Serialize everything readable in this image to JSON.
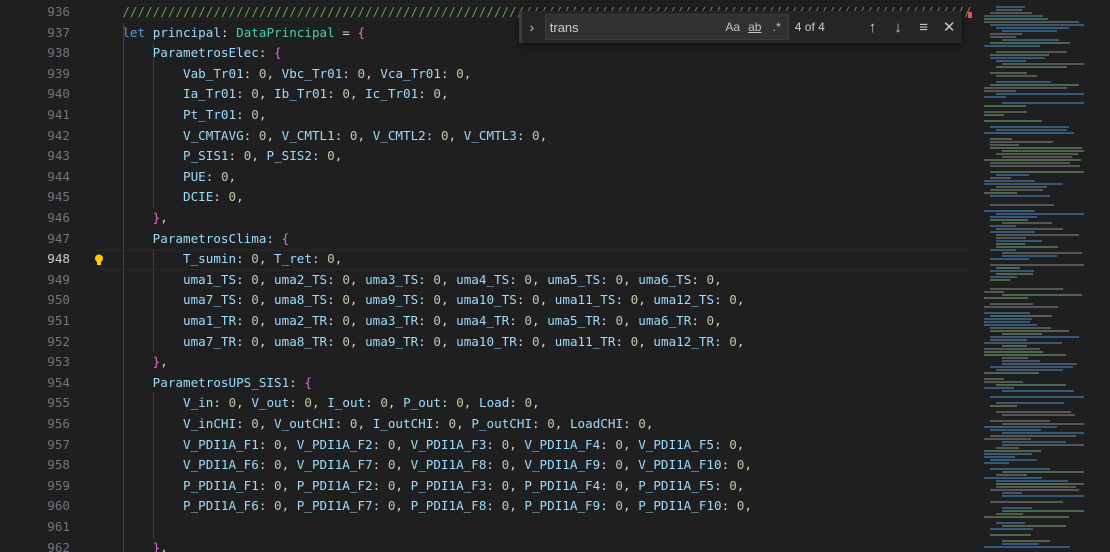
{
  "find_widget": {
    "query": "trans",
    "match_case_label": "Aa",
    "whole_word_label": "ab",
    "regex_label": ".*",
    "match_count": "4 of 4"
  },
  "active_line": "948",
  "lines": [
    {
      "n": "936",
      "t": "    ////////////////////////////////////////////////////////////////////////////////////////////////////////////////////////////"
    },
    {
      "n": "937",
      "t": "    let principal: DataPrincipal = {"
    },
    {
      "n": "938",
      "t": "        ParametrosElec: {"
    },
    {
      "n": "939",
      "t": "            Vab_Tr01: 0, Vbc_Tr01: 0, Vca_Tr01: 0,"
    },
    {
      "n": "940",
      "t": "            Ia_Tr01: 0, Ib_Tr01: 0, Ic_Tr01: 0,"
    },
    {
      "n": "941",
      "t": "            Pt_Tr01: 0,"
    },
    {
      "n": "942",
      "t": "            V_CMTAVG: 0, V_CMTL1: 0, V_CMTL2: 0, V_CMTL3: 0,"
    },
    {
      "n": "943",
      "t": "            P_SIS1: 0, P_SIS2: 0,"
    },
    {
      "n": "944",
      "t": "            PUE: 0,"
    },
    {
      "n": "945",
      "t": "            DCIE: 0,"
    },
    {
      "n": "946",
      "t": "        },"
    },
    {
      "n": "947",
      "t": "        ParametrosClima: {"
    },
    {
      "n": "948",
      "t": "            T_sumin: 0, T_ret: 0,"
    },
    {
      "n": "949",
      "t": "            uma1_TS: 0, uma2_TS: 0, uma3_TS: 0, uma4_TS: 0, uma5_TS: 0, uma6_TS: 0,"
    },
    {
      "n": "950",
      "t": "            uma7_TS: 0, uma8_TS: 0, uma9_TS: 0, uma10_TS: 0, uma11_TS: 0, uma12_TS: 0,"
    },
    {
      "n": "951",
      "t": "            uma1_TR: 0, uma2_TR: 0, uma3_TR: 0, uma4_TR: 0, uma5_TR: 0, uma6_TR: 0,"
    },
    {
      "n": "952",
      "t": "            uma7_TR: 0, uma8_TR: 0, uma9_TR: 0, uma10_TR: 0, uma11_TR: 0, uma12_TR: 0,"
    },
    {
      "n": "953",
      "t": "        },"
    },
    {
      "n": "954",
      "t": "        ParametrosUPS_SIS1: {"
    },
    {
      "n": "955",
      "t": "            V_in: 0, V_out: 0, I_out: 0, P_out: 0, Load: 0,"
    },
    {
      "n": "956",
      "t": "            V_inCHI: 0, V_outCHI: 0, I_outCHI: 0, P_outCHI: 0, LoadCHI: 0,"
    },
    {
      "n": "957",
      "t": "            V_PDI1A_F1: 0, V_PDI1A_F2: 0, V_PDI1A_F3: 0, V_PDI1A_F4: 0, V_PDI1A_F5: 0,"
    },
    {
      "n": "958",
      "t": "            V_PDI1A_F6: 0, V_PDI1A_F7: 0, V_PDI1A_F8: 0, V_PDI1A_F9: 0, V_PDI1A_F10: 0,"
    },
    {
      "n": "959",
      "t": "            P_PDI1A_F1: 0, P_PDI1A_F2: 0, P_PDI1A_F3: 0, P_PDI1A_F4: 0, P_PDI1A_F5: 0,"
    },
    {
      "n": "960",
      "t": "            P_PDI1A_F6: 0, P_PDI1A_F7: 0, P_PDI1A_F8: 0, P_PDI1A_F9: 0, P_PDI1A_F10: 0,"
    },
    {
      "n": "961",
      "t": ""
    },
    {
      "n": "962",
      "t": "        },"
    }
  ],
  "icons": {
    "lightbulb": "lightbulb-icon",
    "toggle_replace": "chevron-right-icon",
    "prev": "arrow-up-icon",
    "next": "arrow-down-icon",
    "find_in_selection": "find-in-selection-icon",
    "close": "close-icon"
  },
  "colors": {
    "keyword": "#569cd6",
    "identifier": "#9cdcfe",
    "type": "#4ec9b0",
    "number": "#b5cea8",
    "brace": "#da70d6",
    "comment": "#6a9955",
    "background": "#1f1f1f"
  }
}
